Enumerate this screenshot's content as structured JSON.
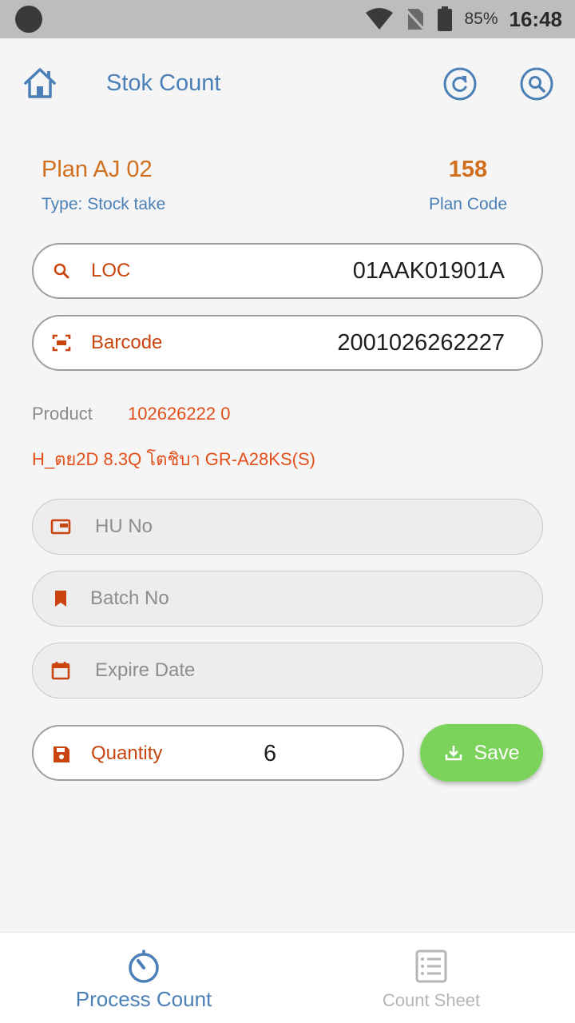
{
  "status_bar": {
    "battery": "85%",
    "time": "16:48"
  },
  "header": {
    "title": "Stok Count",
    "home_icon": "home-icon",
    "refresh_icon": "refresh-icon",
    "search_icon": "search-icon"
  },
  "plan": {
    "name": "Plan AJ 02",
    "type": "Type: Stock take",
    "code": "158",
    "code_label": "Plan Code"
  },
  "fields": {
    "loc": {
      "label": "LOC",
      "value": "01AAK01901A",
      "icon": "search-icon"
    },
    "barcode": {
      "label": "Barcode",
      "value": "2001026262227",
      "icon": "barcode-scan-icon"
    }
  },
  "product": {
    "label": "Product",
    "code": "102626222 0",
    "description": "H_ตย2D 8.3Q โตชิบา GR-A28KS(S)"
  },
  "optional_fields": {
    "hu_no": {
      "placeholder": "HU No",
      "icon": "card-icon"
    },
    "batch_no": {
      "placeholder": "Batch No",
      "icon": "bookmark-icon"
    },
    "expire_date": {
      "placeholder": "Expire Date",
      "icon": "calendar-icon"
    }
  },
  "quantity": {
    "label": "Quantity",
    "value": "6",
    "icon": "save-disk-icon"
  },
  "save_button": {
    "label": "Save",
    "icon": "download-icon"
  },
  "bottom_nav": [
    {
      "label": "Process Count",
      "active": true,
      "icon": "timer-icon"
    },
    {
      "label": "Count Sheet",
      "active": false,
      "icon": "list-sheet-icon"
    }
  ],
  "colors": {
    "primary_blue": "#4a80b7",
    "accent_orange": "#d0701e",
    "label_red": "#c9440e",
    "product_red": "#e34f1a",
    "save_green": "#7cd35c"
  }
}
